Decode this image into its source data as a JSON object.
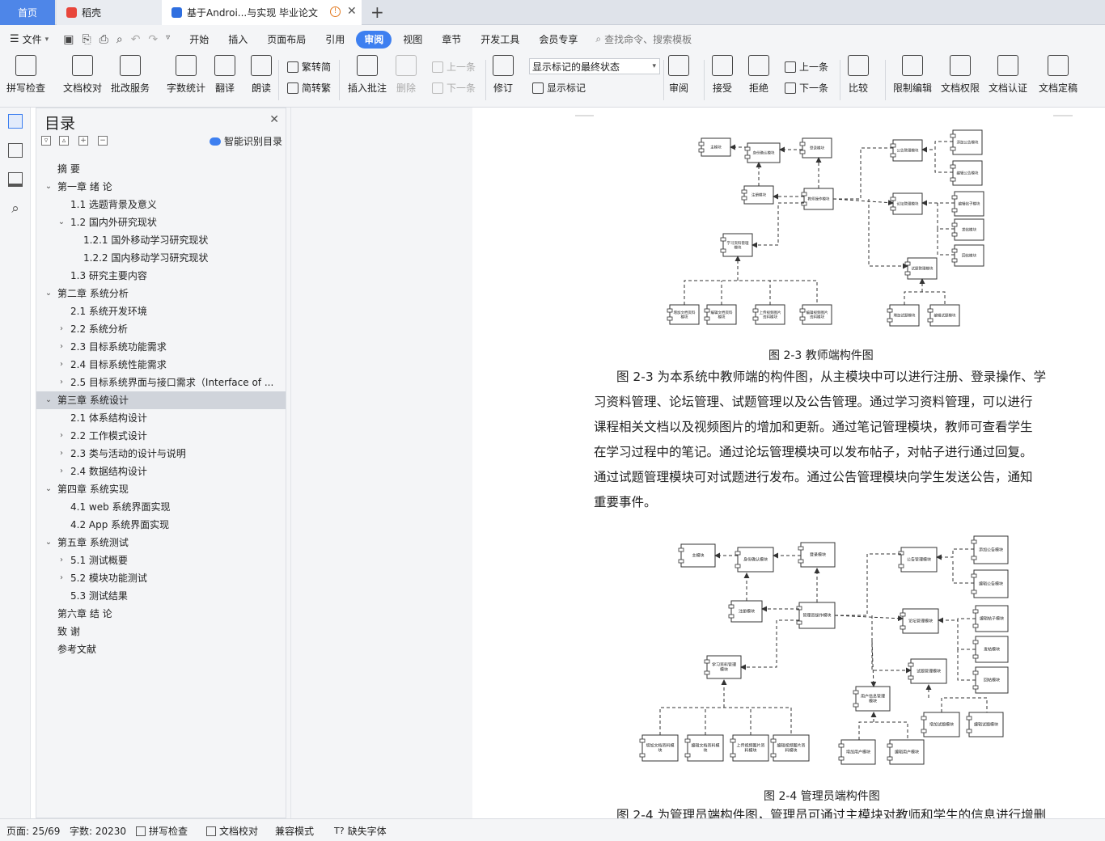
{
  "tabs": {
    "home": "首页",
    "daoke": "稻壳",
    "doc": "基于Androi...与实现 毕业论文",
    "new_tab": "+"
  },
  "menu": {
    "file": "文件",
    "items": [
      "开始",
      "插入",
      "页面布局",
      "引用",
      "审阅",
      "视图",
      "章节",
      "开发工具",
      "会员专享"
    ],
    "active": "审阅",
    "search": "查找命令、搜索模板"
  },
  "ribbon": {
    "spell": "拼写检查",
    "proof": "文档校对",
    "annot_service": "批改服务",
    "wordcount": "字数统计",
    "translate": "翻译",
    "read": "朗读",
    "trad": "繁转简",
    "simp": "简转繁",
    "insert_comment": "插入批注",
    "delete": "删除",
    "prev_comment": "上一条",
    "next_comment": "下一条",
    "revise": "修订",
    "display_select": "显示标记的最终状态",
    "show_marks": "显示标记",
    "review": "审阅",
    "accept": "接受",
    "reject": "拒绝",
    "prev": "上一条",
    "next": "下一条",
    "compare": "比较",
    "restrict": "限制编辑",
    "permission": "文档权限",
    "certify": "文档认证",
    "finalize": "文档定稿"
  },
  "toc": {
    "title": "目录",
    "smart": "智能识别目录",
    "items": [
      {
        "label": "摘  要",
        "level": 0,
        "chev": ""
      },
      {
        "label": "第一章  绪  论",
        "level": 0,
        "chev": "open"
      },
      {
        "label": "1.1 选题背景及意义",
        "level": 1,
        "chev": ""
      },
      {
        "label": "1.2 国内外研究现状",
        "level": 1,
        "chev": "open"
      },
      {
        "label": "1.2.1 国外移动学习研究现状",
        "level": 2,
        "chev": ""
      },
      {
        "label": "1.2.2 国内移动学习研究现状",
        "level": 2,
        "chev": ""
      },
      {
        "label": "1.3 研究主要内容",
        "level": 1,
        "chev": ""
      },
      {
        "label": "第二章  系统分析",
        "level": 0,
        "chev": "open"
      },
      {
        "label": "2.1 系统开发环境",
        "level": 1,
        "chev": ""
      },
      {
        "label": "2.2 系统分析",
        "level": 1,
        "chev": "closed"
      },
      {
        "label": "2.3 目标系统功能需求",
        "level": 1,
        "chev": "closed"
      },
      {
        "label": "2.4 目标系统性能需求",
        "level": 1,
        "chev": "closed"
      },
      {
        "label": "2.5 目标系统界面与接口需求（Interface of ...",
        "level": 1,
        "chev": "closed"
      },
      {
        "label": "第三章  系统设计",
        "level": 0,
        "chev": "open",
        "selected": true
      },
      {
        "label": "2.1  体系结构设计",
        "level": 1,
        "chev": ""
      },
      {
        "label": "2.2  工作模式设计",
        "level": 1,
        "chev": "closed"
      },
      {
        "label": "2.3 类与活动的设计与说明",
        "level": 1,
        "chev": "closed"
      },
      {
        "label": "2.4 数据结构设计",
        "level": 1,
        "chev": "closed"
      },
      {
        "label": "第四章  系统实现",
        "level": 0,
        "chev": "open"
      },
      {
        "label": "4.1 web 系统界面实现",
        "level": 1,
        "chev": ""
      },
      {
        "label": "4.2 App 系统界面实现",
        "level": 1,
        "chev": ""
      },
      {
        "label": "第五章  系统测试",
        "level": 0,
        "chev": "open"
      },
      {
        "label": "5.1 测试概要",
        "level": 1,
        "chev": "closed"
      },
      {
        "label": "5.2 模块功能测试",
        "level": 1,
        "chev": "closed"
      },
      {
        "label": "5.3  测试结果",
        "level": 1,
        "chev": ""
      },
      {
        "label": "第六章  结  论",
        "level": 0,
        "chev": ""
      },
      {
        "label": "致  谢",
        "level": 0,
        "chev": ""
      },
      {
        "label": "参考文献",
        "level": 0,
        "chev": ""
      }
    ]
  },
  "document": {
    "fig1_caption": "图 2-3  教师端构件图",
    "fig1_boxes": {
      "main": "主模块",
      "auth": "身份确认模块",
      "login": "登录模块",
      "register": "注册模块",
      "teacher_op": "教师操作模块",
      "notice_mgr": "公告管理模块",
      "add_notice": "添加公告模块",
      "edit_notice": "编辑公告模块",
      "forum_mgr": "论坛管理模块",
      "edit_post": "编辑帖子模块",
      "post": "发帖模块",
      "reply": "回帖模块",
      "study_mgr": "学习资料管理模块",
      "quiz_mgr": "试题管理模块",
      "add_doc": "增加文档资料模块",
      "edit_doc": "编辑文档资料模块",
      "upload_video": "上传视频图片资料模块",
      "edit_video": "编辑视频图片资料模块",
      "add_quiz": "增加试题模块",
      "edit_quiz": "编辑试题模块"
    },
    "para1": [
      "图 2-3 为本系统中教师端的构件图，从主模块中可以进行注册、登录操作、学",
      "习资料管理、论坛管理、试题管理以及公告管理。通过学习资料管理，可以进行",
      "课程相关文档以及视频图片的增加和更新。通过笔记管理模块，教师可查看学生",
      "在学习过程中的笔记。通过论坛管理模块可以发布帖子，对帖子进行通过回复。",
      "通过试题管理模块可对试题进行发布。通过公告管理模块向学生发送公告，通知",
      "重要事件。"
    ],
    "fig2_caption": "图 2-4  管理员端构件图",
    "fig2_boxes": {
      "main": "主模块",
      "auth": "身份确认模块",
      "login": "登录模块",
      "register": "注册模块",
      "admin_op": "管理员操作模块",
      "notice_mgr": "公告管理模块",
      "add_notice": "添加公告模块",
      "edit_notice": "编辑公告模块",
      "forum_mgr": "论坛管理模块",
      "edit_post": "编辑帖子模块",
      "post": "发帖模块",
      "reply": "回帖模块",
      "study_mgr": "学习资料管理模块",
      "quiz_mgr": "试题管理模块",
      "user_mgr": "用户信息管理模块",
      "add_doc": "增加文档资料模块",
      "edit_doc": "编辑文档资料模块",
      "upload_video": "上传视频图片资料模块",
      "edit_video": "编辑视频图片资料模块",
      "add_quiz": "增加试题模块",
      "edit_quiz": "编辑试题模块",
      "add_user": "增加用户模块",
      "edit_user": "编辑用户模块"
    },
    "para2_partial": "图 2-4 为管理员端构件图，管理员可通过主模块对教师和学生的信息进行增删"
  },
  "status": {
    "page": "页面: 25/69",
    "words": "字数: 20230",
    "spell": "拼写检查",
    "proof": "文档校对",
    "compat": "兼容模式",
    "missing_font": "缺失字体"
  },
  "colors": {
    "accent": "#3d7ff0",
    "tab_home": "#4e86e8",
    "selected_row": "#d0d4db"
  }
}
